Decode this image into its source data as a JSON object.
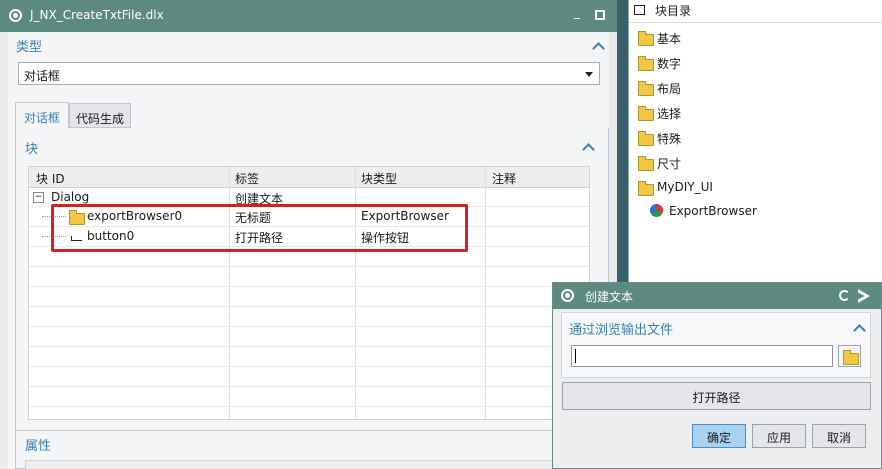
{
  "main_window": {
    "title": "J_NX_CreateTxtFile.dlx",
    "min_label": "_",
    "type_section": "类型",
    "type_value": "对话框",
    "tabs": [
      "对话框",
      "代码生成"
    ],
    "block_section": "块",
    "grid_headers": [
      "块 ID",
      "标签",
      "块类型",
      "注释"
    ],
    "rows": [
      {
        "id": "Dialog",
        "label": "创建文本",
        "type": "",
        "note": ""
      },
      {
        "id": "exportBrowser0",
        "label": "无标题",
        "type": "ExportBrowser",
        "note": ""
      },
      {
        "id": "button0",
        "label": "打开路径",
        "type": "操作按钮",
        "note": ""
      }
    ],
    "tree_toggle": "−",
    "props_section": "属性"
  },
  "catalog": {
    "title": "块目录",
    "items": [
      "基本",
      "数字",
      "布局",
      "选择",
      "特殊",
      "尺寸",
      "MyDIY_UI"
    ],
    "sub_item": "ExportBrowser"
  },
  "popup": {
    "title": "创建文本",
    "group_label": "通过浏览输出文件",
    "input_value": "",
    "open_path_label": "打开路径",
    "ok_label": "确定",
    "apply_label": "应用",
    "cancel_label": "取消"
  },
  "colors": {
    "title_bar": "#5c8a80",
    "section_label": "#3d7fb0",
    "highlight_box": "#d42020",
    "ok_button": "#a9d2f0"
  }
}
